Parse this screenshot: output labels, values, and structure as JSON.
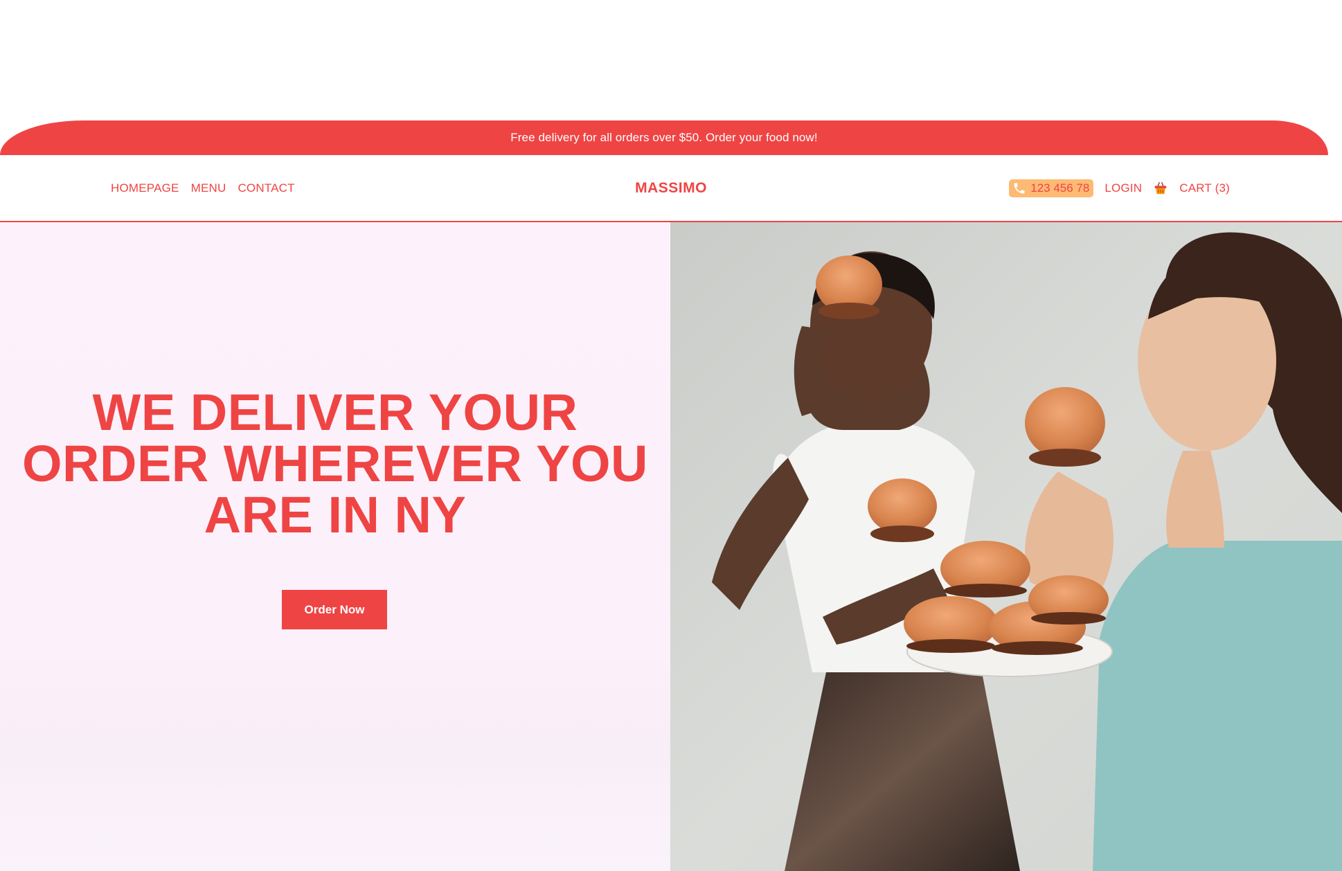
{
  "banner": {
    "text": "Free delivery for all orders over $50. Order your food now!"
  },
  "nav": {
    "links": [
      {
        "label": "HOMEPAGE"
      },
      {
        "label": "MENU"
      },
      {
        "label": "CONTACT"
      }
    ],
    "brand": "MASSIMO",
    "phone": {
      "icon": "phone-icon",
      "number": "123 456 78"
    },
    "login": "LOGIN",
    "cart": {
      "icon": "basket-icon",
      "label": "CART (3)"
    }
  },
  "hero": {
    "title": "WE DELIVER YOUR ORDER WHEREVER YOU ARE IN NY",
    "cta": "Order Now",
    "image_alt": "Two women smiling while eating burgers from a plate"
  },
  "colors": {
    "accent": "#ef4444",
    "phone_chip": "#fdba74",
    "hero_bg": "#fdf2fb",
    "white": "#ffffff"
  }
}
